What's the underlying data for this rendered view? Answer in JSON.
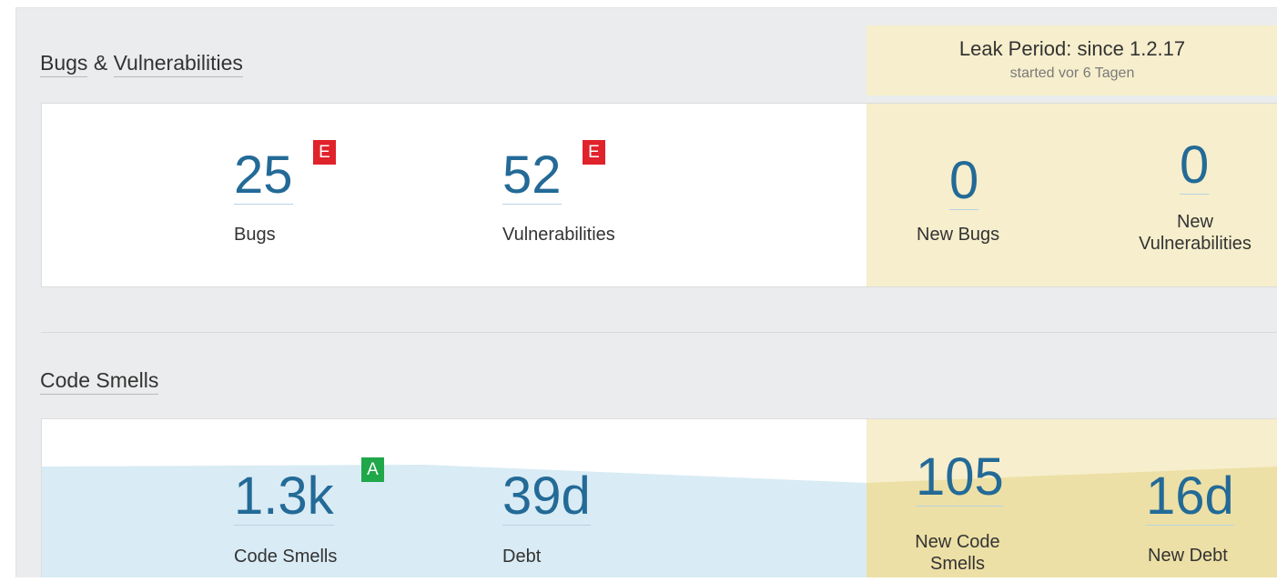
{
  "leak_period": {
    "title": "Leak Period: since 1.2.17",
    "subtitle": "started vor 6 Tagen"
  },
  "bugs_section": {
    "title_part1": "Bugs",
    "title_amp": "&",
    "title_part2": "Vulnerabilities",
    "bugs": {
      "value": "25",
      "label": "Bugs",
      "rating": "E"
    },
    "vulnerabilities": {
      "value": "52",
      "label": "Vulnerabilities",
      "rating": "E"
    },
    "new_bugs": {
      "value": "0",
      "label": "New Bugs"
    },
    "new_vulnerabilities": {
      "value": "0",
      "label_line1": "New",
      "label_line2": "Vulnerabilities"
    }
  },
  "code_smells_section": {
    "title": "Code Smells",
    "code_smells": {
      "value": "1.3k",
      "label": "Code Smells",
      "rating": "A"
    },
    "debt": {
      "value": "39d",
      "label": "Debt"
    },
    "new_code_smells": {
      "value": "105",
      "label_line1": "New Code",
      "label_line2": "Smells"
    },
    "new_debt": {
      "value": "16d",
      "label": "New Debt"
    }
  },
  "colors": {
    "metric_blue": "#236a97",
    "rating_e": "#e0222b",
    "rating_a": "#1fa74a",
    "leak_bg": "#f6eecc",
    "area_blue": "#d9ebf5",
    "area_leak": "#ede0a6"
  }
}
